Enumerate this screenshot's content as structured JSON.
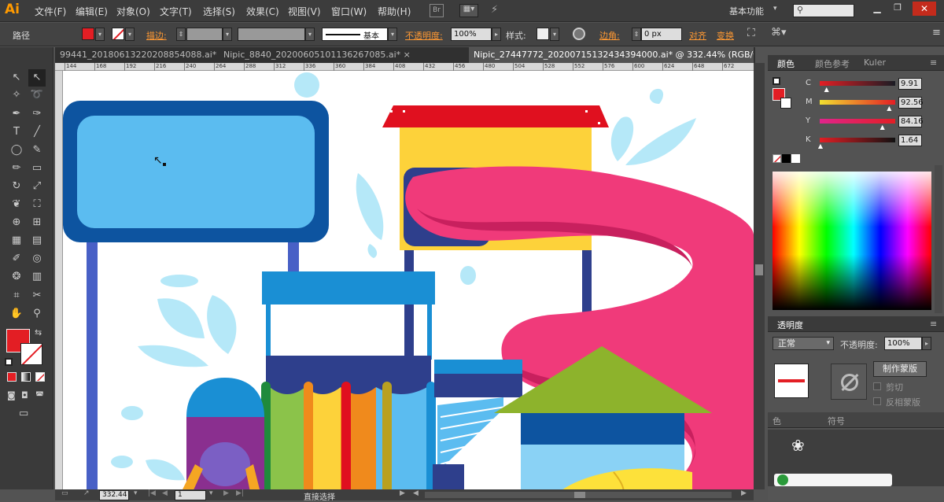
{
  "app": {
    "logo": "Ai"
  },
  "menu": [
    "文件(F)",
    "编辑(E)",
    "对象(O)",
    "文字(T)",
    "选择(S)",
    "效果(C)",
    "视图(V)",
    "窗口(W)",
    "帮助(H)"
  ],
  "menu_right": {
    "workspace": "基本功能",
    "bridge": "Br"
  },
  "control": {
    "selection": "路径",
    "stroke_label": "描边:",
    "stroke_style": "基本",
    "opacity_label": "不透明度:",
    "opacity_value": "100%",
    "style_label": "样式:",
    "corner_label": "边角:",
    "corner_value": "0 px",
    "align_label": "对齐",
    "transform_label": "变换"
  },
  "tabs": [
    {
      "label": "99441_20180613220208854088.ai*",
      "active": false
    },
    {
      "label": "Nipic_8840_20200605101136267085.ai*",
      "active": false
    },
    {
      "label": "Nipic_27447772_20200715132434394000.ai* @ 332.44% (RGB/预览)",
      "active": true
    }
  ],
  "ruler_ticks": [
    "144",
    "168",
    "192",
    "216",
    "240",
    "264",
    "288",
    "312",
    "336",
    "360",
    "384",
    "408",
    "432",
    "456",
    "480",
    "504",
    "528",
    "552",
    "576",
    "600",
    "624",
    "648",
    "672"
  ],
  "status": {
    "zoom": "332.44",
    "page": "1",
    "tool": "直接选择"
  },
  "color_panel": {
    "tabs": [
      "颜色",
      "颜色参考",
      "Kuler"
    ],
    "channels": [
      {
        "name": "C",
        "value": "9.91",
        "pos": 0.1
      },
      {
        "name": "M",
        "value": "92.56",
        "pos": 0.93
      },
      {
        "name": "Y",
        "value": "84.16",
        "pos": 0.84
      },
      {
        "name": "K",
        "value": "1.64",
        "pos": 0.02
      }
    ]
  },
  "transparency_panel": {
    "title": "透明度",
    "blend_mode": "正常",
    "opacity_label": "不透明度:",
    "opacity_value": "100%",
    "make_mask": "制作蒙版",
    "clip": "剪切",
    "invert": "反相蒙版"
  },
  "bottom_tabs": [
    "色",
    "符号"
  ],
  "colors": {
    "fill": "#e31e24",
    "accent": "#ff9933"
  }
}
